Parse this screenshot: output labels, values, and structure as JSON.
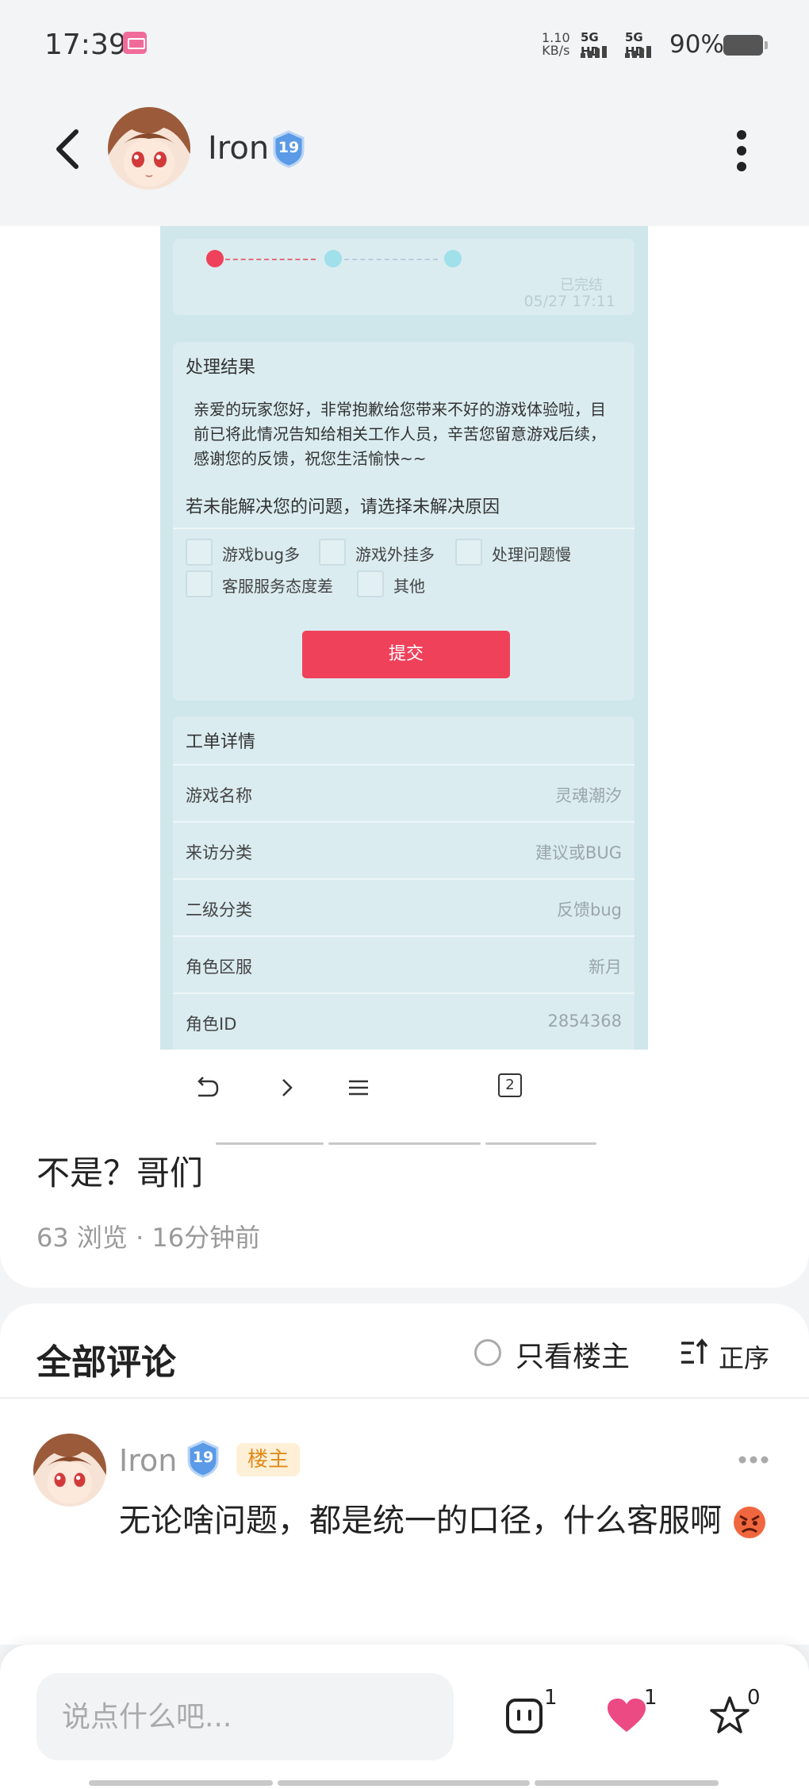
{
  "status_bar": {
    "time": "17:39",
    "net_speed_value": "1.10",
    "net_speed_unit": "KB/s",
    "signal_1": "5G HD",
    "signal_2": "5G HD",
    "battery": "90%"
  },
  "header": {
    "username": "Iron",
    "level": "19"
  },
  "ticket": {
    "progress_done_label": "已完结",
    "progress_done_time": "05/27 17:11",
    "result_title": "处理结果",
    "result_message": "亲爱的玩家您好，非常抱歉给您带来不好的游戏体验啦，目前已将此情况告知给相关工作人员，辛苦您留意游戏后续，感谢您的反馈，祝您生活愉快~~",
    "unresolved_prompt": "若未能解决您的问题，请选择未解决原因",
    "options": [
      "游戏bug多",
      "游戏外挂多",
      "处理问题慢",
      "客服服务态度差",
      "其他"
    ],
    "submit_label": "提交",
    "detail_title": "工单详情",
    "details": [
      {
        "key": "游戏名称",
        "value": "灵魂潮汐"
      },
      {
        "key": "来访分类",
        "value": "建议或BUG"
      },
      {
        "key": "二级分类",
        "value": "反馈bug"
      },
      {
        "key": "角色区服",
        "value": "新月"
      },
      {
        "key": "角色ID",
        "value": "2854368"
      }
    ],
    "nav_tab_count": "2"
  },
  "post": {
    "text": "不是？哥们",
    "meta": "63 浏览 · 16分钟前"
  },
  "comments": {
    "heading": "全部评论",
    "only_op_label": "只看楼主",
    "sort_label": "正序",
    "items": [
      {
        "name": "Iron",
        "level": "19",
        "tag": "楼主",
        "text": "无论啥问题，都是统一的口径，什么客服啊"
      }
    ]
  },
  "bottom_bar": {
    "input_placeholder": "说点什么吧...",
    "comment_count": "1",
    "like_count": "1",
    "favorite_count": "0"
  },
  "colors": {
    "accent_red": "#f0415b",
    "like_pink": "#ec4a83",
    "op_tag_bg": "#fdf0d6",
    "op_tag_text": "#e08a1b",
    "level_badge": "#5b9ae6"
  }
}
